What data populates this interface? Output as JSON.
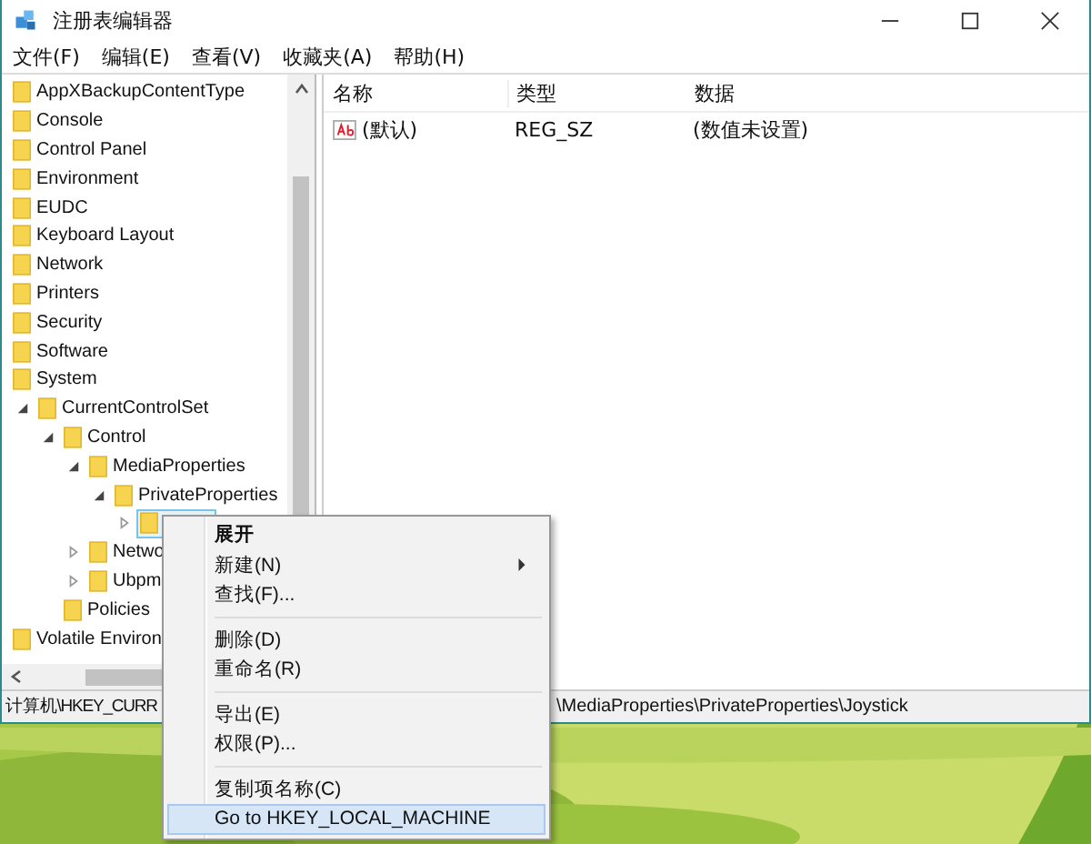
{
  "window": {
    "title": "注册表编辑器"
  },
  "menu_bar": [
    "文件(F)",
    "编辑(E)",
    "查看(V)",
    "收藏夹(A)",
    "帮助(H)"
  ],
  "tree": [
    {
      "label": "AppXBackupContentType",
      "selected": false
    },
    {
      "label": "Console",
      "selected": false
    },
    {
      "label": "Control Panel",
      "selected": false
    },
    {
      "label": "Environment",
      "selected": false
    },
    {
      "label": "EUDC",
      "selected": false
    },
    {
      "label": "Keyboard Layout",
      "selected": false
    },
    {
      "label": "Network",
      "selected": false
    },
    {
      "label": "Printers",
      "selected": false
    },
    {
      "label": "Security",
      "selected": false
    },
    {
      "label": "Software",
      "selected": false
    },
    {
      "label": "System",
      "selected": false,
      "children": [
        {
          "label": "CurrentControlSet",
          "selected": false,
          "expanded": true,
          "children": [
            {
              "label": "Control",
              "selected": false,
              "expanded": true,
              "children": [
                {
                  "label": "MediaProperties",
                  "selected": false,
                  "expanded": true,
                  "children": [
                    {
                      "label": "PrivateProperties",
                      "selected": false,
                      "expanded": true,
                      "children": [
                        {
                          "selected": true,
                          "expanded": false
                        }
                      ]
                    }
                  ]
                },
                {
                  "label": "Netwo",
                  "selected": false,
                  "expanded": false
                },
                {
                  "label": "Ubpm",
                  "selected": false,
                  "expanded": false
                }
              ]
            },
            {
              "label": "Policies",
              "selected": false
            }
          ]
        }
      ]
    },
    {
      "label": "Volatile Environ",
      "selected": false
    }
  ],
  "values_table": {
    "columns": [
      "名称",
      "类型",
      "数据"
    ],
    "rows": [
      {
        "name": "(默认)",
        "type": "REG_SZ",
        "data": "(数值未设置)"
      }
    ]
  },
  "status_bar": {
    "path_start": "计算机\\HKEY_CURR",
    "path_end": "\\MediaProperties\\PrivateProperties\\Joystick"
  },
  "context_menu": [
    {
      "kind": "item",
      "label": "展开",
      "bold": true,
      "submenu": false,
      "selected": false
    },
    {
      "kind": "item",
      "label": "新建(N)",
      "bold": false,
      "submenu": true,
      "selected": false
    },
    {
      "kind": "item",
      "label": "查找(F)...",
      "bold": false,
      "submenu": false,
      "selected": false
    },
    {
      "kind": "separator"
    },
    {
      "kind": "item",
      "label": "删除(D)",
      "bold": false,
      "submenu": false,
      "selected": false
    },
    {
      "kind": "item",
      "label": "重命名(R)",
      "bold": false,
      "submenu": false,
      "selected": false
    },
    {
      "kind": "separator"
    },
    {
      "kind": "item",
      "label": "导出(E)",
      "bold": false,
      "submenu": false,
      "selected": false
    },
    {
      "kind": "item",
      "label": "权限(P)...",
      "bold": false,
      "submenu": false,
      "selected": false
    },
    {
      "kind": "separator"
    },
    {
      "kind": "item",
      "label": "复制项名称(C)",
      "bold": false,
      "submenu": false,
      "selected": false
    },
    {
      "kind": "item",
      "label": "Go to HKEY_LOCAL_MACHINE",
      "bold": false,
      "submenu": false,
      "selected": true
    }
  ]
}
